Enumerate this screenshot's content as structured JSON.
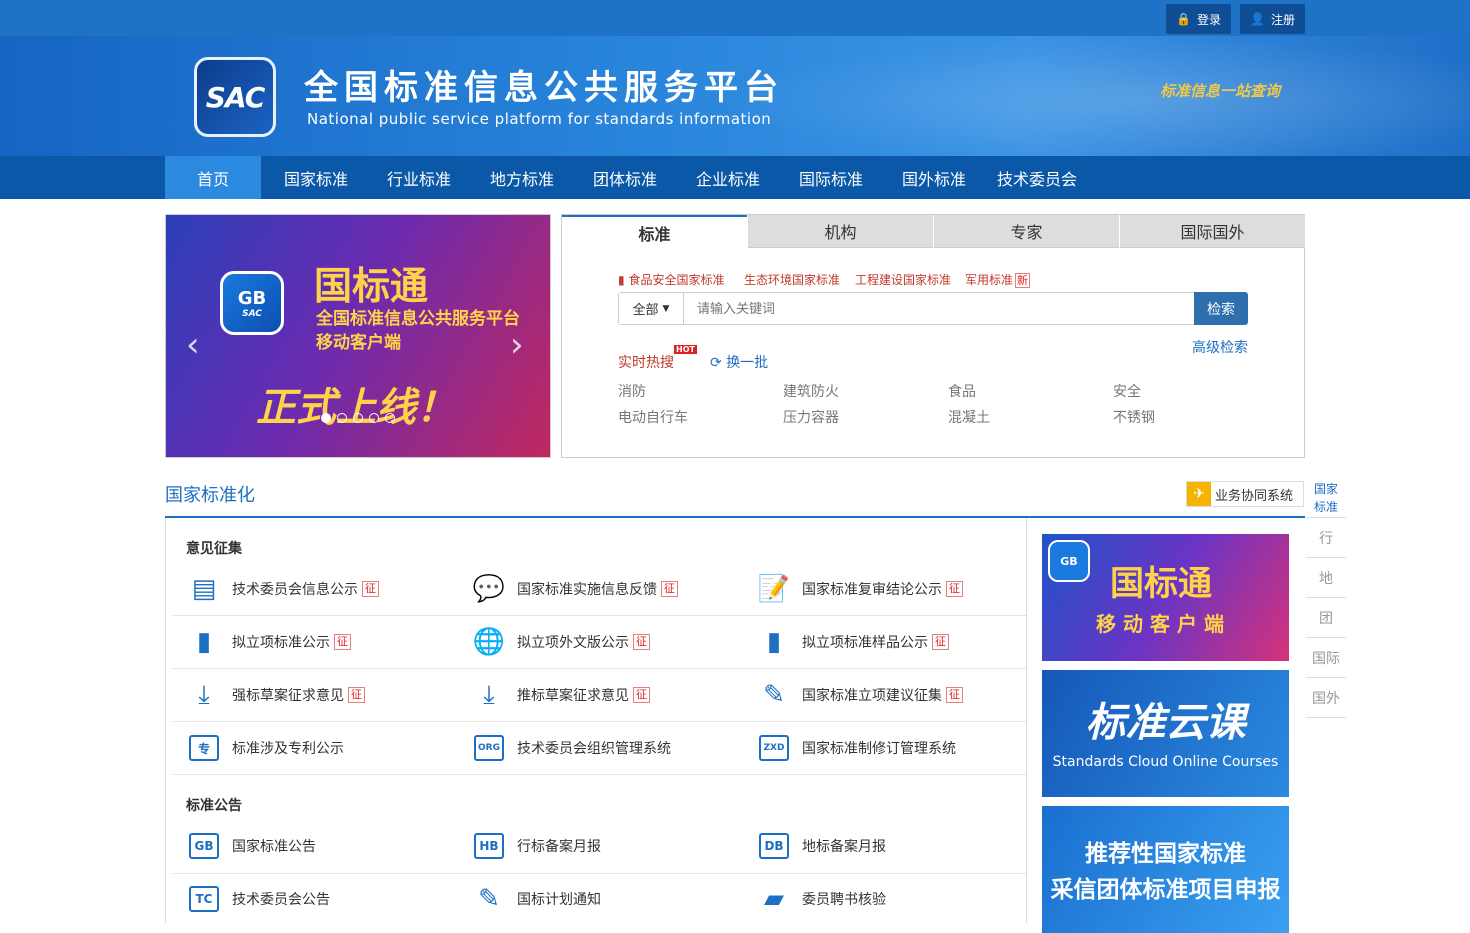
{
  "topbar": {
    "login": "登录",
    "register": "注册"
  },
  "header": {
    "logo_text": "SAC",
    "title": "全国标准信息公共服务平台",
    "subtitle": "National public service platform  for standards information",
    "slogan": "标准信息一站查询"
  },
  "nav": {
    "items": [
      "首页",
      "国家标准",
      "行业标准",
      "地方标准",
      "团体标准",
      "企业标准",
      "国际标准",
      "国外标准",
      "技术委员会"
    ]
  },
  "carousel": {
    "badge_top": "GB",
    "badge_bottom": "SAC",
    "title": "国标通",
    "subtitle": "全国标准信息公共服务平台移动客户端",
    "tagline": "正式上线！",
    "prev": "‹",
    "next": "›",
    "slide_count": 5,
    "active_slide": 1
  },
  "search": {
    "tabs": [
      "标准",
      "机构",
      "专家",
      "国际国外"
    ],
    "quick_links": [
      "食品安全国家标准",
      "生态环境国家标准",
      "工程建设国家标准",
      "军用标准"
    ],
    "new_badge": "新",
    "scope": "全部",
    "placeholder": "请输入关键词",
    "button": "检索",
    "advanced": "高级检索",
    "hot_label": "实时热搜",
    "hot_badge": "HOT",
    "refresh": "换一批",
    "keywords": [
      "消防",
      "建筑防火",
      "食品",
      "安全",
      "电动自行车",
      "压力容器",
      "混凝土",
      "不锈钢"
    ]
  },
  "section": {
    "title": "国家标准化",
    "biz_system": "业务协同系统"
  },
  "sidenav": {
    "items": [
      "国家标准",
      "行",
      "地",
      "团",
      "国际",
      "国外"
    ]
  },
  "groups": {
    "opinion": {
      "title": "意见征集",
      "badge": "征",
      "items": [
        {
          "label": "技术委员会信息公示",
          "icon": "id-card-icon"
        },
        {
          "label": "国家标准实施信息反馈",
          "icon": "chat-bubble-icon"
        },
        {
          "label": "国家标准复审结论公示",
          "icon": "document-edit-icon"
        },
        {
          "label": "拟立项标准公示",
          "icon": "bookmark-icon"
        },
        {
          "label": "拟立项外文版公示",
          "icon": "globe-icon"
        },
        {
          "label": "拟立项标准样品公示",
          "icon": "bookmark-icon"
        },
        {
          "label": "强标草案征求意见",
          "icon": "download-tray-icon"
        },
        {
          "label": "推标草案征求意见",
          "icon": "download-tray-icon"
        },
        {
          "label": "国家标准立项建议征集",
          "icon": "edit-icon"
        },
        {
          "label": "标准涉及专利公示",
          "icon": "patent-doc-icon"
        },
        {
          "label": "技术委员会组织管理系统",
          "icon": "monitor-org-icon"
        },
        {
          "label": "国家标准制修订管理系统",
          "icon": "monitor-zxd-icon"
        }
      ],
      "badged": [
        true,
        true,
        true,
        true,
        true,
        true,
        true,
        true,
        true,
        false,
        false,
        false
      ],
      "icon_text": [
        "",
        "",
        "",
        "",
        "",
        "",
        "",
        "",
        "",
        "专",
        "ORG",
        "ZXD"
      ]
    },
    "notice": {
      "title": "标准公告",
      "items": [
        {
          "label": "国家标准公告",
          "icon": "gb-doc-icon",
          "icon_text": "GB"
        },
        {
          "label": "行标备案月报",
          "icon": "hb-doc-icon",
          "icon_text": "HB"
        },
        {
          "label": "地标备案月报",
          "icon": "db-doc-icon",
          "icon_text": "DB"
        },
        {
          "label": "技术委员会公告",
          "icon": "tc-doc-icon",
          "icon_text": "TC"
        },
        {
          "label": "国标计划通知",
          "icon": "pen-doc-icon",
          "icon_text": ""
        },
        {
          "label": "委员聘书核验",
          "icon": "folder-lock-icon",
          "icon_text": ""
        }
      ]
    }
  },
  "promos": [
    {
      "badge": "GB",
      "title": "国标通",
      "subtitle": "移动客户端"
    },
    {
      "title": "标准云课",
      "subtitle": "Standards Cloud Online Courses"
    },
    {
      "title": "推荐性国家标准",
      "subtitle": "采信团体标准项目申报"
    }
  ],
  "colors": {
    "primary": "#1d6fc4",
    "nav": "#0b58a8",
    "nav_active": "#2b8ae0",
    "accent_red": "#c0392b",
    "gold": "#ffd24a"
  }
}
